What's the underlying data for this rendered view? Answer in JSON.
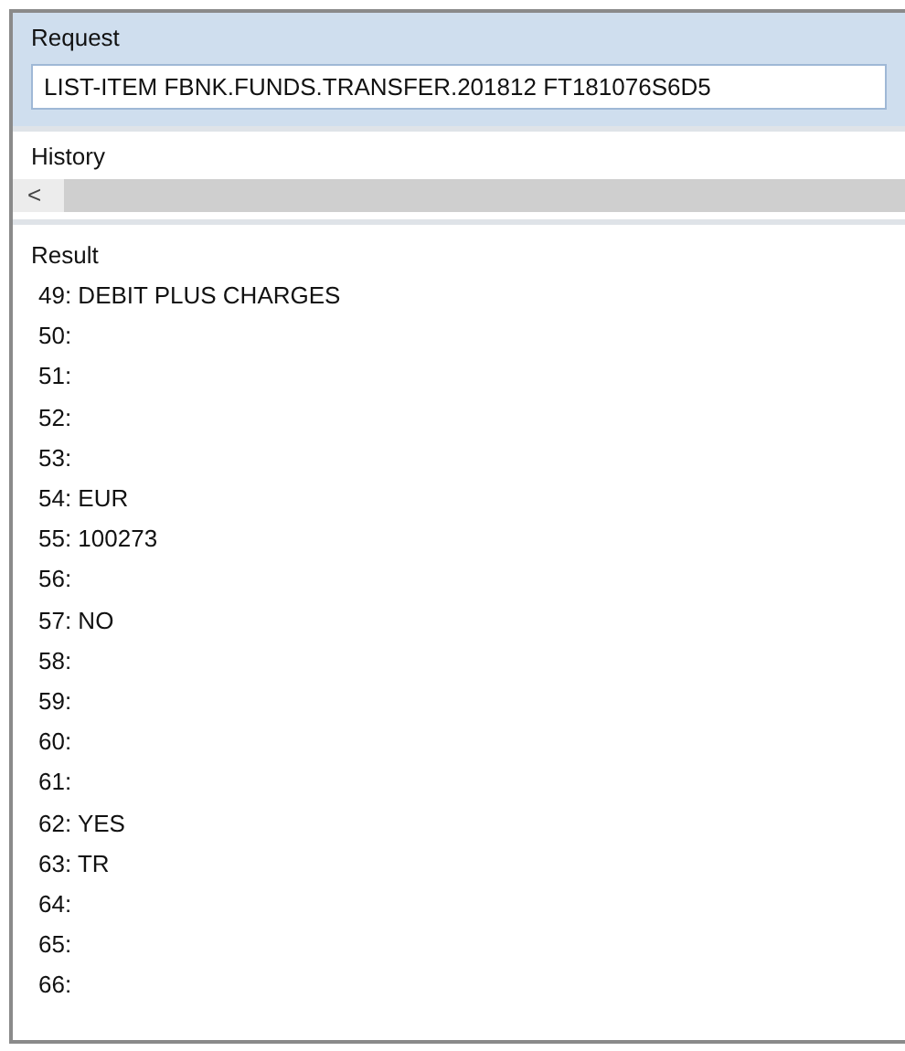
{
  "request": {
    "label": "Request",
    "value": "LIST-ITEM FBNK.FUNDS.TRANSFER.201812 FT181076S6D5"
  },
  "history": {
    "label": "History",
    "scroll_left": "<"
  },
  "result": {
    "label": "Result",
    "lines": [
      "49: DEBIT PLUS CHARGES",
      "50:",
      "51:",
      "52:",
      "53:",
      "54: EUR",
      "55: 100273",
      "56:",
      "57: NO",
      "58:",
      "59:",
      "60:",
      "61:",
      "62: YES",
      "63: TR",
      "64:",
      "65:",
      "66:"
    ]
  }
}
